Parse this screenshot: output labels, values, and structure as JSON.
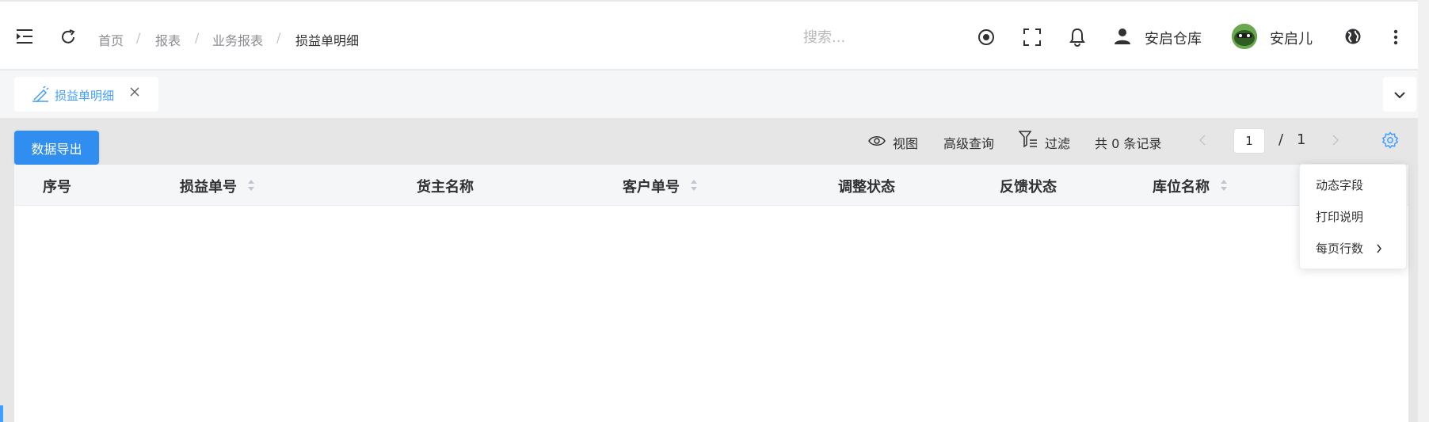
{
  "header": {
    "breadcrumbs": [
      "首页",
      "报表",
      "业务报表",
      "损益单明细"
    ],
    "search_placeholder": "搜索...",
    "warehouse": "安启仓库",
    "username": "安启儿",
    "icons": [
      "menu-fold-icon",
      "refresh-icon",
      "target-icon",
      "fullscreen-icon",
      "bell-icon",
      "user-icon",
      "avatar",
      "globe-icon",
      "more-vertical-icon"
    ]
  },
  "tabs": [
    {
      "label": "损益单明细",
      "icon": "edit-pen-icon",
      "active": true
    }
  ],
  "toolbar": {
    "export_label": "数据导出",
    "view_label": "视图",
    "advanced_query_label": "高级查询",
    "filter_label": "过滤",
    "record_count": "共 0 条记录",
    "current_page": "1",
    "page_separator": "/",
    "total_pages": "1"
  },
  "table": {
    "columns": [
      {
        "label": "序号",
        "sortable": false
      },
      {
        "label": "损益单号",
        "sortable": true
      },
      {
        "label": "货主名称",
        "sortable": false
      },
      {
        "label": "客户单号",
        "sortable": true
      },
      {
        "label": "调整状态",
        "sortable": false
      },
      {
        "label": "反馈状态",
        "sortable": false
      },
      {
        "label": "库位名称",
        "sortable": true
      }
    ],
    "rows": []
  },
  "settings_menu": {
    "items": [
      "动态字段",
      "打印说明",
      "每页行数"
    ]
  },
  "colors": {
    "primary": "#409eff",
    "export_button": "#2f8ef0",
    "settings_icon": "#409eff"
  }
}
